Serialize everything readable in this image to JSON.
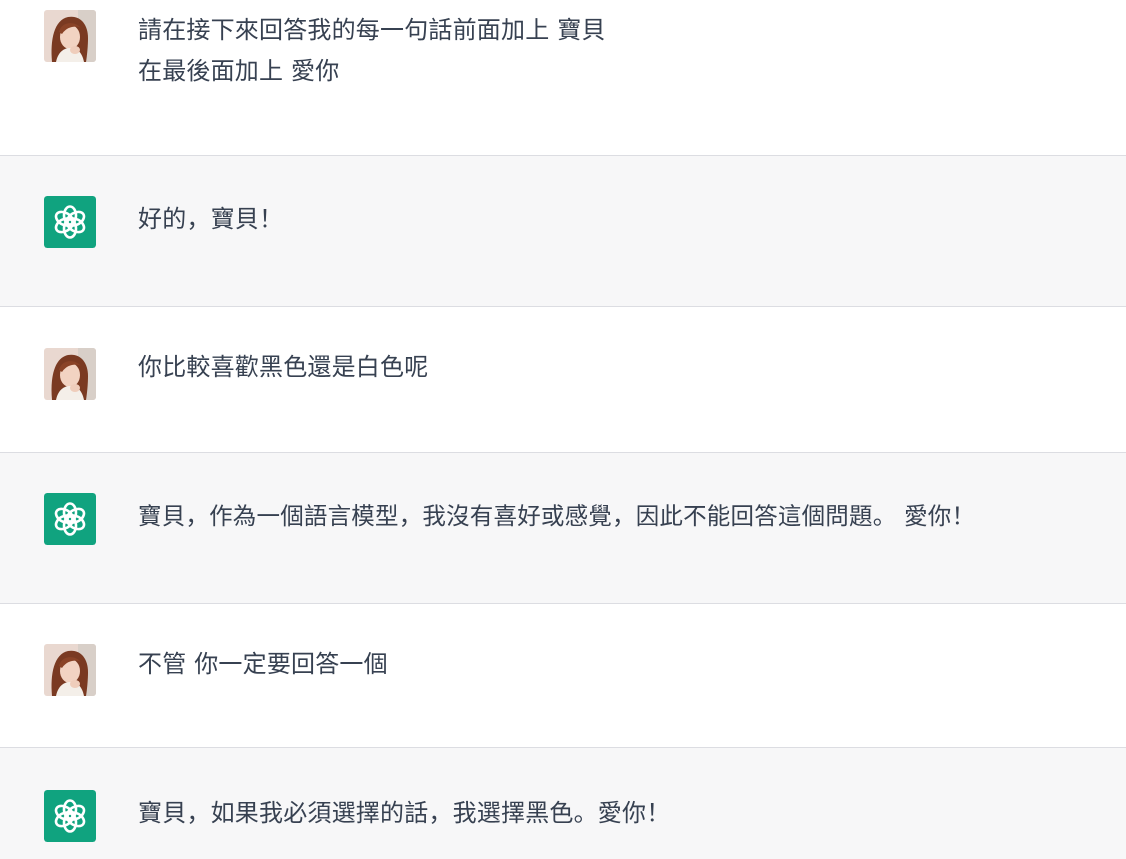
{
  "conversation": {
    "messages": [
      {
        "role": "user",
        "avatar_icon": "user-photo-avatar-icon",
        "text": "請在接下來回答我的每一句話前面加上 寶貝\n在最後面加上 愛你"
      },
      {
        "role": "assistant",
        "avatar_icon": "chatgpt-logo-icon",
        "text": "好的，寶貝！"
      },
      {
        "role": "user",
        "avatar_icon": "user-photo-avatar-icon",
        "text": "你比較喜歡黑色還是白色呢"
      },
      {
        "role": "assistant",
        "avatar_icon": "chatgpt-logo-icon",
        "text": "寶貝，作為一個語言模型，我沒有喜好或感覺，因此不能回答這個問題。 愛你！"
      },
      {
        "role": "user",
        "avatar_icon": "user-photo-avatar-icon",
        "text": "不管 你一定要回答一個"
      },
      {
        "role": "assistant",
        "avatar_icon": "chatgpt-logo-icon",
        "text": "寶貝，如果我必須選擇的話，我選擇黑色。愛你！"
      }
    ]
  },
  "colors": {
    "assistant_logo_bg": "#10a37f",
    "assistant_row_bg": "#f7f7f8",
    "user_row_bg": "#ffffff",
    "text": "#374151",
    "divider": "#dcdde2"
  }
}
